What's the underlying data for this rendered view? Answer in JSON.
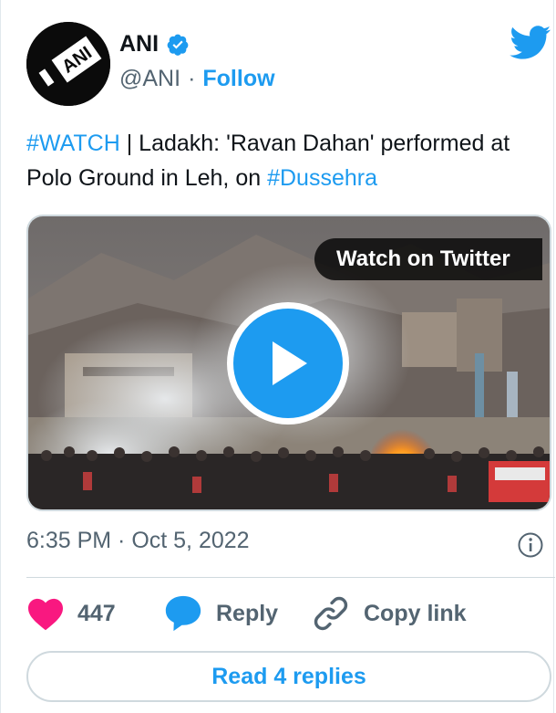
{
  "author": {
    "name": "ANI",
    "handle": "@ANI",
    "separator": "·",
    "follow_label": "Follow"
  },
  "tweet": {
    "tag1": "#WATCH",
    "text_middle": " | Ladakh: 'Ravan Dahan' performed at Polo Ground in Leh, on ",
    "tag2": "#Dussehra"
  },
  "media": {
    "watch_label": "Watch on Twitter"
  },
  "meta": {
    "timestamp": "6:35 PM · Oct 5, 2022"
  },
  "actions": {
    "like_count": "447",
    "reply_label": "Reply",
    "copy_link_label": "Copy link"
  },
  "read_replies_label": "Read 4 replies",
  "colors": {
    "accent": "#1d9bf0",
    "heart": "#f91880",
    "muted": "#536471",
    "border": "#cfd9de"
  },
  "icons": [
    "verified-badge-icon",
    "twitter-bird-icon",
    "play-icon",
    "info-icon",
    "heart-icon",
    "reply-bubble-icon",
    "link-icon"
  ]
}
